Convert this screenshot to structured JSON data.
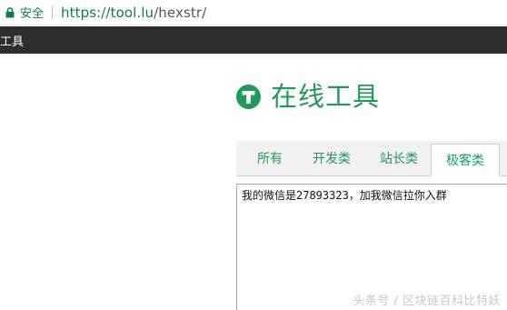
{
  "browser": {
    "secure_label": "安全",
    "url_host": "https://tool.lu",
    "url_path": "/hexstr/"
  },
  "nav": {
    "title": "工具"
  },
  "logo": {
    "text": "在线工具"
  },
  "tabs": [
    {
      "label": "所有"
    },
    {
      "label": "开发类"
    },
    {
      "label": "站长类"
    },
    {
      "label": "极客类",
      "active": true
    }
  ],
  "editor": {
    "value": "我的微信是27893323，加我微信拉你入群"
  },
  "watermark": {
    "text": "头条号 / 区块链百科比特妖"
  },
  "colors": {
    "brand_green": "#1e9a5c",
    "secure_green": "#0b8043",
    "nav_dark": "#2e2e2e"
  }
}
